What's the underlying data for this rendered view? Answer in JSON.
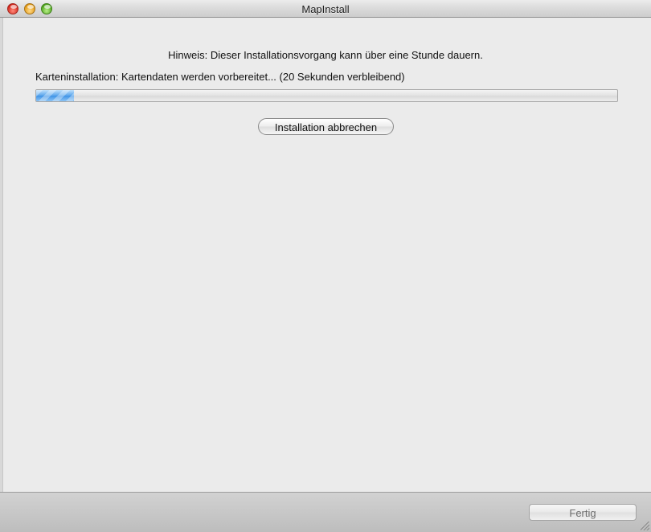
{
  "window": {
    "title": "MapInstall"
  },
  "main": {
    "notice": "Hinweis: Dieser Installationsvorgang kann über eine Stunde dauern.",
    "status": "Karteninstallation: Kartendaten werden vorbereitet... (20 Sekunden verbleibend)",
    "progress_percent": 6.5,
    "cancel_label": "Installation abbrechen"
  },
  "footer": {
    "done_label": "Fertig"
  },
  "colors": {
    "progress_accent": "#4a9be8",
    "close_button": "#d3251b",
    "minimize_button": "#e29a12",
    "zoom_button": "#4fa51b"
  },
  "icons": {
    "close": "close-icon",
    "minimize": "minimize-icon",
    "zoom": "zoom-icon",
    "resize": "resize-grip-icon"
  }
}
